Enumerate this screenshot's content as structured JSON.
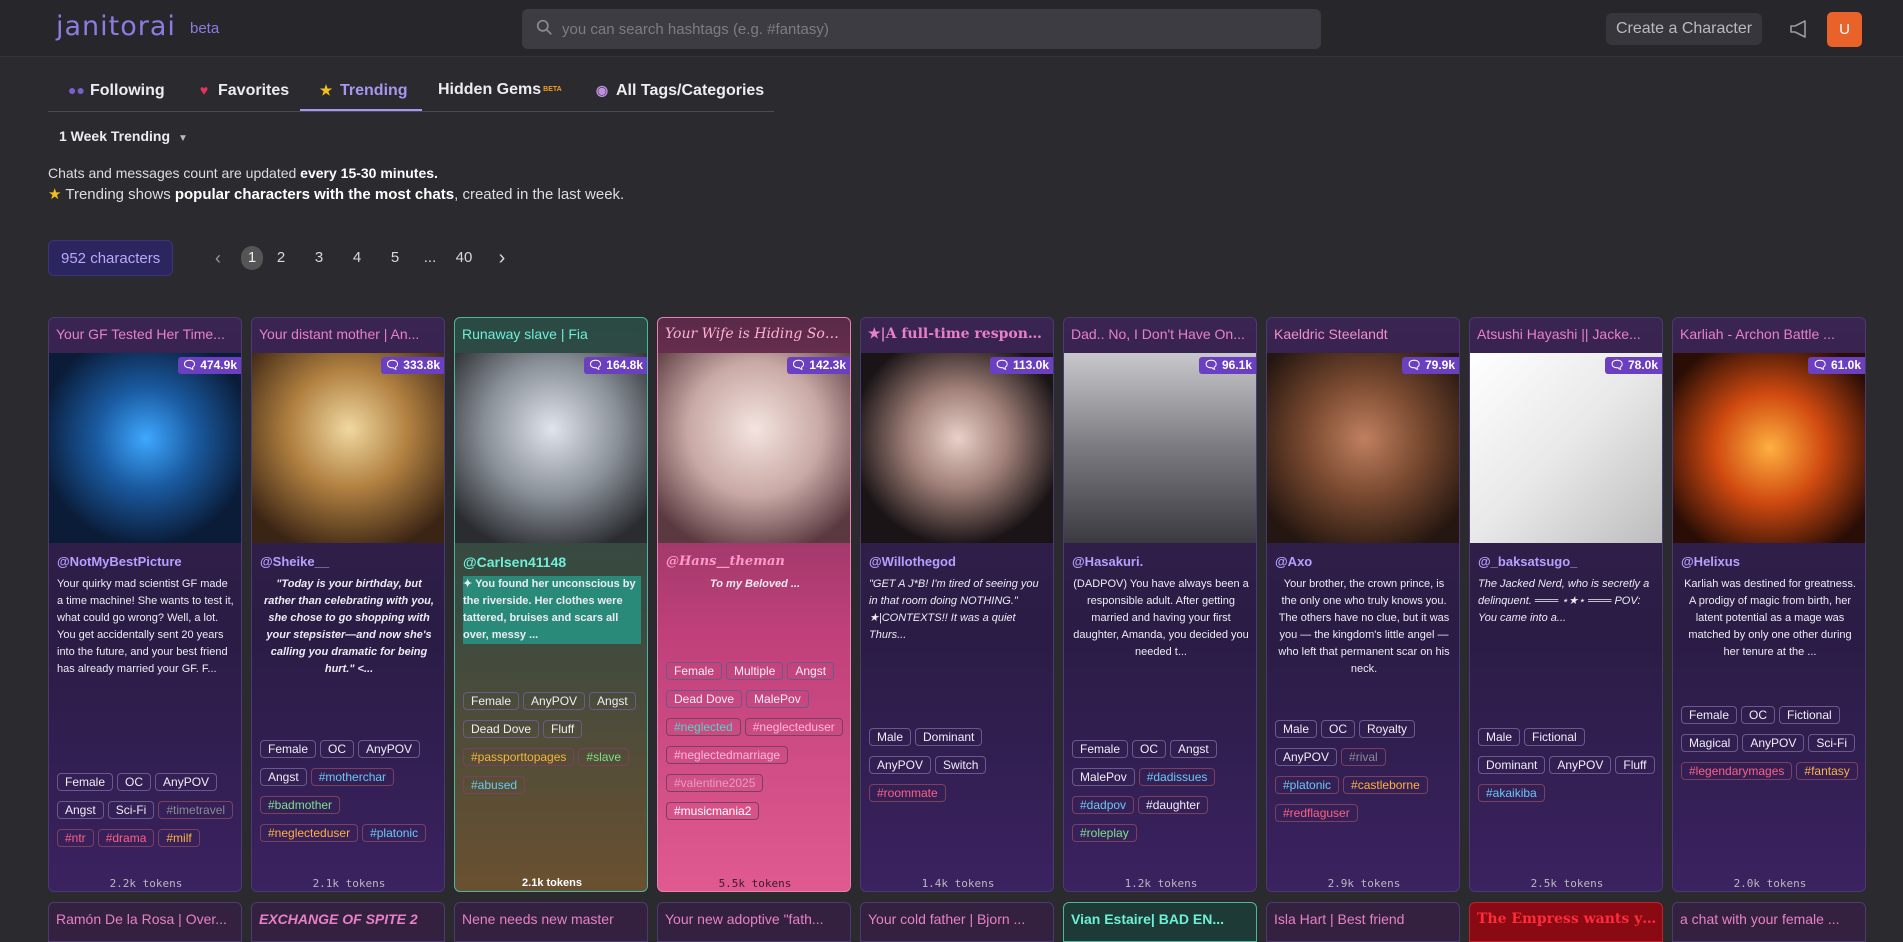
{
  "brand": {
    "name": "janitorai",
    "beta": "beta"
  },
  "search": {
    "placeholder": "you can search hashtags (e.g. #fantasy)"
  },
  "header": {
    "create_label": "Create a Character",
    "avatar_initial": "U"
  },
  "tabs": [
    {
      "label": "Following",
      "icon": "people-icon"
    },
    {
      "label": "Favorites",
      "icon": "heart-icon"
    },
    {
      "label": "Trending",
      "icon": "star-icon",
      "active": true
    },
    {
      "label": "Hidden Gems",
      "badge": "BETA"
    },
    {
      "label": "All Tags/Categories",
      "icon": "tag-icon"
    }
  ],
  "trend_filter": {
    "selected": "1 Week Trending"
  },
  "info": {
    "line1_prefix": "Chats and messages count are updated ",
    "line1_bold": "every 15-30 minutes.",
    "line2_prefix": "Trending shows ",
    "line2_bold": "popular characters with the most chats",
    "line2_suffix": ", created in the last week."
  },
  "pagination": {
    "count_label": "952 characters",
    "pages": [
      "1",
      "2",
      "3",
      "4",
      "5",
      "...",
      "40"
    ],
    "current": "1"
  },
  "colors": {
    "accent": "#a896f0",
    "card_chat_badge": "#6a3fc0",
    "avatar": "#e8622a"
  },
  "cards": [
    {
      "title": "Your GF Tested Her Time...",
      "chats": "474.9k",
      "author": "@NotMyBestPicture",
      "desc": "Your quirky mad scientist GF made a time machine! She wants to test it, what could go wrong? Well, a lot. You get accidentally sent 20 years into the future, and your best friend has already married your GF. F...",
      "tags": [
        "Female",
        "OC",
        "AnyPOV",
        "Angst",
        "Sci-Fi"
      ],
      "hashtags": [
        "#timetravel",
        "#ntr",
        "#drama",
        "#milf"
      ],
      "tokens": "2.2k tokens"
    },
    {
      "title": "Your distant mother | An...",
      "chats": "333.8k",
      "author": "@Sheike__",
      "desc": "\"Today is your birthday, but rather than celebrating with you, she chose to go shopping with your stepsister—and now she's calling you dramatic for being hurt.\" <...",
      "tags": [
        "Female",
        "OC",
        "AnyPOV",
        "Angst"
      ],
      "hashtags": [
        "#motherchar",
        "#badmother",
        "#neglecteduser",
        "#platonic"
      ],
      "tokens": "2.1k tokens"
    },
    {
      "title": "Runaway slave | Fia",
      "chats": "164.8k",
      "author": "@Carlsen41148",
      "desc": "✦ You found her unconscious by the riverside. Her clothes were tattered, bruises and scars all over, messy ...",
      "tags": [
        "Female",
        "AnyPOV",
        "Angst",
        "Dead Dove",
        "Fluff"
      ],
      "hashtags": [
        "#passporttopages",
        "#slave",
        "#abused"
      ],
      "tokens": "2.1k tokens"
    },
    {
      "title": "Your Wife is Hiding Somet...",
      "chats": "142.3k",
      "author": "@Hans__theman",
      "desc": "To my Beloved ...",
      "tags": [
        "Female",
        "Multiple",
        "Angst",
        "Dead Dove",
        "MalePov"
      ],
      "hashtags": [
        "#neglected",
        "#neglecteduser",
        "#neglectedmarriage",
        "#valentine2025",
        "#musicmania2"
      ],
      "tokens": "5.5k tokens"
    },
    {
      "title": "★|A full-time responsible ...",
      "chats": "113.0k",
      "author": "@Willothegod",
      "desc": "\"GET A J*B! I'm tired of seeing you in that room doing NOTHING.\" ★|CONTEXTS!! It was a quiet Thurs...",
      "tags": [
        "Male",
        "Dominant",
        "AnyPOV",
        "Switch"
      ],
      "hashtags": [
        "#roommate"
      ],
      "tokens": "1.4k tokens"
    },
    {
      "title": "Dad.. No, I Don't Have On...",
      "chats": "96.1k",
      "author": "@Hasakuri.",
      "desc": "(DADPOV) You have always been a responsible adult. After getting married and having your first daughter, Amanda, you decided you needed t...",
      "tags": [
        "Female",
        "OC",
        "Angst",
        "MalePov"
      ],
      "hashtags": [
        "#dadissues",
        "#dadpov",
        "#daughter",
        "#roleplay"
      ],
      "tokens": "1.2k tokens"
    },
    {
      "title": "Kaeldric Steelandt",
      "chats": "79.9k",
      "author": "@Axo",
      "desc": "Your brother, the crown prince, is the only one who truly knows you. The others have no clue, but it was you — the kingdom's little angel — who left that permanent scar on his neck.",
      "tags": [
        "Male",
        "OC",
        "Royalty",
        "AnyPOV"
      ],
      "hashtags": [
        "#rival",
        "#platonic",
        "#castleborne",
        "#redflaguser"
      ],
      "tokens": "2.9k tokens"
    },
    {
      "title": "Atsushi Hayashi || Jacke...",
      "chats": "78.0k",
      "author": "@_baksatsugo_",
      "desc": "The Jacked Nerd, who is secretly a delinquent. ═══ ⋆★⋆ ═══ POV: You came into a...",
      "tags": [
        "Male",
        "Fictional",
        "Dominant",
        "AnyPOV",
        "Fluff"
      ],
      "hashtags": [
        "#akaikiba"
      ],
      "tokens": "2.5k tokens"
    },
    {
      "title": "Karliah - Archon Battle ...",
      "chats": "61.0k",
      "author": "@Helixus",
      "desc": "Karliah was destined for greatness. A prodigy of magic from birth, her latent potential as a mage was matched by only one other during her tenure at the ...",
      "tags": [
        "Female",
        "OC",
        "Fictional",
        "Magical",
        "AnyPOV",
        "Sci-Fi"
      ],
      "hashtags": [
        "#legendarymages",
        "#fantasy"
      ],
      "tokens": "2.0k tokens"
    }
  ],
  "next_row": [
    {
      "title": "Ramón De la Rosa | Over..."
    },
    {
      "title": "EXCHANGE OF SPITE 2"
    },
    {
      "title": "Nene needs new master"
    },
    {
      "title": "Your new adoptive \"fath..."
    },
    {
      "title": "Your cold father | Bjorn ..."
    },
    {
      "title": "Vian Estaire| BAD EN..."
    },
    {
      "title": "Isla Hart | Best friend"
    },
    {
      "title": "The Empress wants you..."
    },
    {
      "title": "a chat with your female ..."
    }
  ]
}
